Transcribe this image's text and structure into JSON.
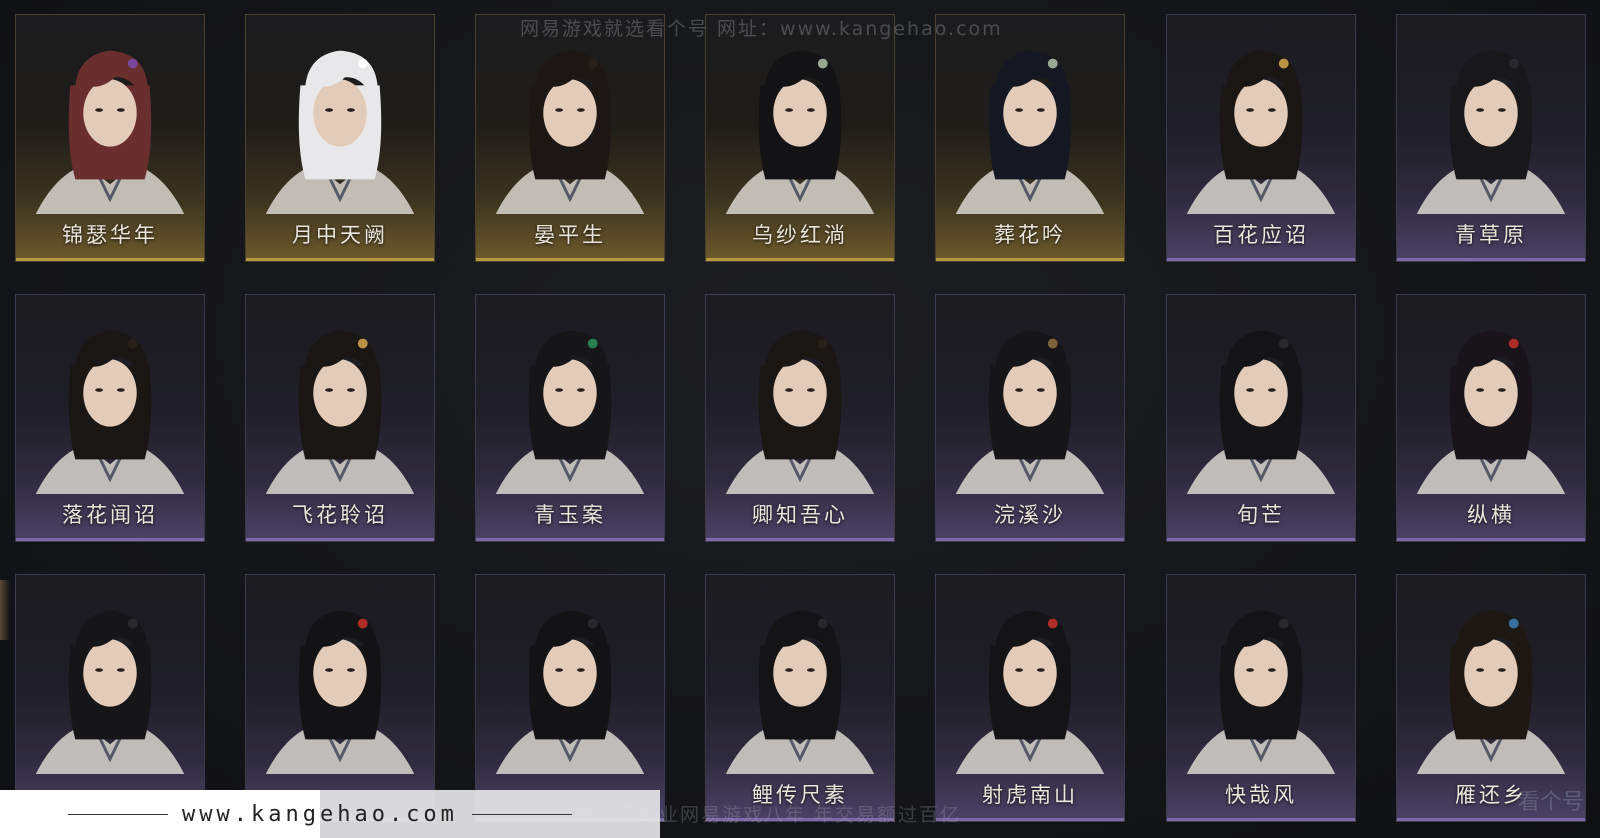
{
  "watermark": {
    "top": "网易游戏就选看个号  网址：www.kangehao.com",
    "bottom": "看个号专业网易游戏八年  年交易额过百亿",
    "logo": "看个号"
  },
  "footer": {
    "url": "www.kangehao.com"
  },
  "hairstyles": [
    {
      "name": "锦瑟华年",
      "tier": "gold",
      "hair": "#6b2e2e",
      "accent": "#7a4aa8"
    },
    {
      "name": "月中天阙",
      "tier": "gold",
      "hair": "#e8e8ea",
      "accent": "#ffffff"
    },
    {
      "name": "晏平生",
      "tier": "gold",
      "hair": "#1c1714",
      "accent": "#2a221c"
    },
    {
      "name": "乌纱红淌",
      "tier": "gold",
      "hair": "#131316",
      "accent": "#a8b8a0"
    },
    {
      "name": "葬花吟",
      "tier": "gold",
      "hair": "#151722",
      "accent": "#a8b8a0"
    },
    {
      "name": "百花应诏",
      "tier": "purple",
      "hair": "#1a1613",
      "accent": "#c9a24a"
    },
    {
      "name": "青草原",
      "tier": "purple",
      "hair": "#18181b",
      "accent": "#2a2a30"
    },
    {
      "name": "落花闻诏",
      "tier": "purple",
      "hair": "#1a1614",
      "accent": "#2a221c"
    },
    {
      "name": "飞花聆诏",
      "tier": "purple",
      "hair": "#1a1614",
      "accent": "#c9a24a"
    },
    {
      "name": "青玉案",
      "tier": "purple",
      "hair": "#161618",
      "accent": "#2e8a5a"
    },
    {
      "name": "卿知吾心",
      "tier": "purple",
      "hair": "#1a1614",
      "accent": "#2a221c"
    },
    {
      "name": "浣溪沙",
      "tier": "purple",
      "hair": "#161618",
      "accent": "#8a6a40"
    },
    {
      "name": "旬芒",
      "tier": "purple",
      "hair": "#141416",
      "accent": "#2a2a30"
    },
    {
      "name": "纵横",
      "tier": "purple",
      "hair": "#18141a",
      "accent": "#c0302a"
    },
    {
      "name": "",
      "tier": "purple",
      "hair": "#161618",
      "accent": "#2a2a30"
    },
    {
      "name": "",
      "tier": "purple",
      "hair": "#131316",
      "accent": "#c0302a"
    },
    {
      "name": "",
      "tier": "purple",
      "hair": "#131316",
      "accent": "#2a2a30"
    },
    {
      "name": "鲤传尺素",
      "tier": "purple",
      "hair": "#141416",
      "accent": "#2a2a30"
    },
    {
      "name": "射虎南山",
      "tier": "purple",
      "hair": "#141416",
      "accent": "#c0302a"
    },
    {
      "name": "快哉风",
      "tier": "purple",
      "hair": "#141416",
      "accent": "#2a2a30"
    },
    {
      "name": "雁还乡",
      "tier": "purple",
      "hair": "#1e1814",
      "accent": "#3a7ab0"
    }
  ]
}
